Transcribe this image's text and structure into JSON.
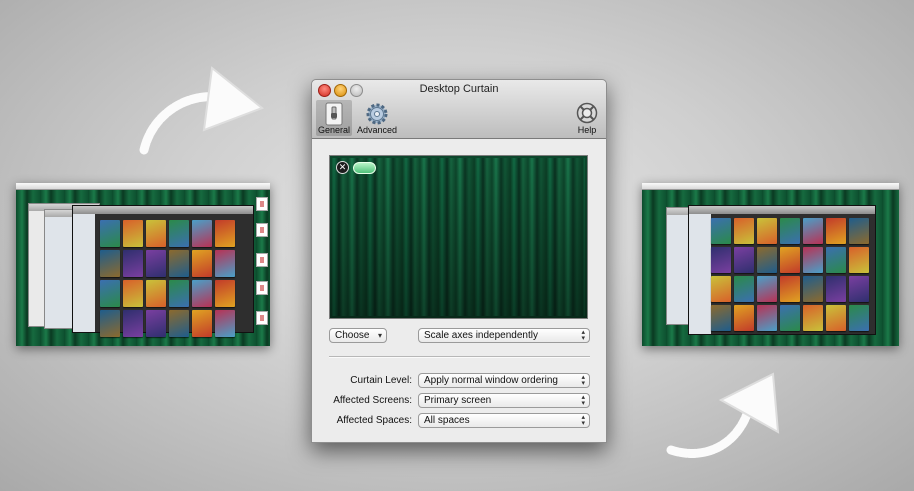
{
  "window": {
    "title": "Desktop Curtain",
    "toolbar": {
      "general": "General",
      "advanced": "Advanced",
      "help": "Help"
    },
    "preview": {
      "close_glyph": "✕"
    },
    "choose_popup": "Choose",
    "scale_popup": "Scale axes independently",
    "form": {
      "curtain_level_label": "Curtain Level:",
      "curtain_level_value": "Apply normal window ordering",
      "affected_screens_label": "Affected Screens:",
      "affected_screens_value": "Primary screen",
      "affected_spaces_label": "Affected Spaces:",
      "affected_spaces_value": "All spaces"
    }
  },
  "icons": {
    "general": "switch-icon",
    "advanced": "gear-icon",
    "help": "lifebuoy-icon",
    "arrows": "hand-drawn-arrow-icon"
  },
  "colors": {
    "curtain_green": "#137148",
    "pill_green": "#4fc27a",
    "background": "#cfcfcf"
  }
}
